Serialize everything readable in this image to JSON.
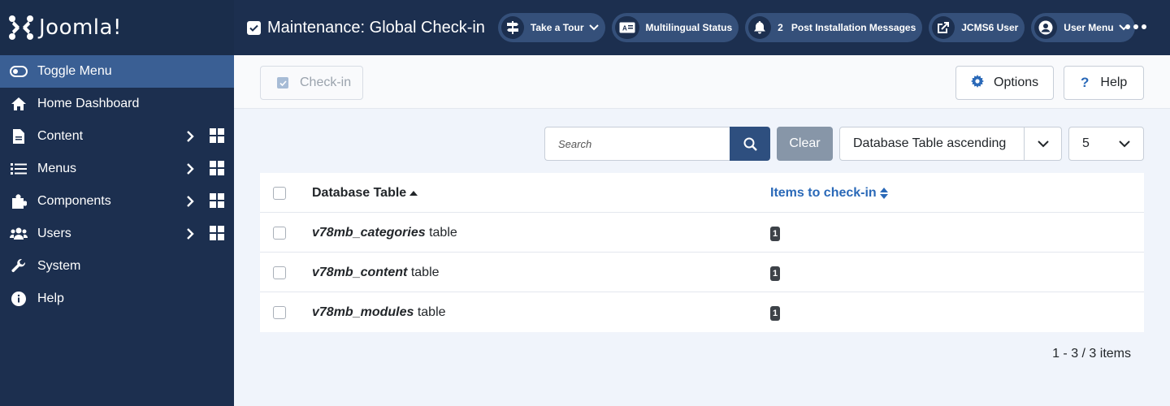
{
  "brand": {
    "name": "Joomla!"
  },
  "header": {
    "title": "Maintenance: Global Check-in",
    "take_tour": "Take a Tour",
    "multilingual": "Multilingual Status",
    "post_install_count": "2",
    "post_install": "Post Installation Messages",
    "site_user": "JCMS6 User",
    "user_menu": "User Menu"
  },
  "sidebar": {
    "toggle": "Toggle Menu",
    "items": [
      {
        "label": "Home Dashboard",
        "icon": "home-icon"
      },
      {
        "label": "Content",
        "icon": "file-icon"
      },
      {
        "label": "Menus",
        "icon": "list-icon"
      },
      {
        "label": "Components",
        "icon": "puzzle-icon"
      },
      {
        "label": "Users",
        "icon": "users-icon"
      },
      {
        "label": "System",
        "icon": "wrench-icon"
      },
      {
        "label": "Help",
        "icon": "info-icon"
      }
    ]
  },
  "toolbar": {
    "checkin": "Check-in",
    "options": "Options",
    "help": "Help"
  },
  "filters": {
    "search_placeholder": "Search",
    "clear": "Clear",
    "sort": "Database Table ascending",
    "limit": "5"
  },
  "table": {
    "col_db": "Database Table",
    "col_items": "Items to check-in",
    "rows": [
      {
        "prefix": "v78mb_categories",
        "suffix": " table",
        "count": "1"
      },
      {
        "prefix": "v78mb_content",
        "suffix": " table",
        "count": "1"
      },
      {
        "prefix": "v78mb_modules",
        "suffix": " table",
        "count": "1"
      }
    ]
  },
  "pagination": {
    "summary": "1 - 3 / 3 items"
  },
  "colors": {
    "sidebar_bg": "#1c2f4f",
    "active_bg": "#3a5f94",
    "link": "#2a69b8"
  }
}
